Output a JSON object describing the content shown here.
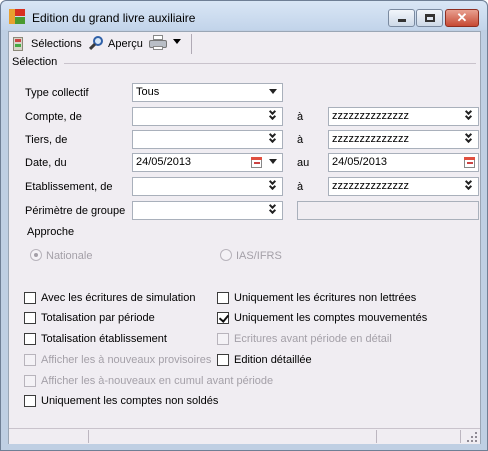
{
  "window": {
    "title": "Edition du grand livre auxiliaire",
    "close_glyph": "✕"
  },
  "toolbar": {
    "selections_label": "Sélections",
    "preview_label": "Aperçu",
    "icons": [
      "document-icon",
      "magnifier-icon",
      "printer-icon",
      "chevron-down-icon"
    ]
  },
  "section": {
    "title": "Sélection"
  },
  "form": {
    "type_collectif": {
      "label": "Type collectif",
      "value": "Tous"
    },
    "compte": {
      "label": "Compte, de",
      "from_value": "",
      "to_label": "à",
      "to_value": "zzzzzzzzzzzzzz"
    },
    "tiers": {
      "label": "Tiers, de",
      "from_value": "",
      "to_label": "à",
      "to_value": "zzzzzzzzzzzzzz"
    },
    "date": {
      "label": "Date, du",
      "from_value": "24/05/2013",
      "to_label": "au",
      "to_value": "24/05/2013"
    },
    "etablissement": {
      "label": "Etablissement, de",
      "from_value": "",
      "to_label": "à",
      "to_value": "zzzzzzzzzzzzzz"
    },
    "perimetre": {
      "label": "Périmètre de groupe",
      "value": "",
      "extra_value": ""
    }
  },
  "approche": {
    "label": "Approche",
    "options": [
      {
        "label": "Nationale",
        "checked": true,
        "enabled": false
      },
      {
        "label": "IAS/IFRS",
        "checked": false,
        "enabled": false
      }
    ]
  },
  "options": {
    "left": [
      {
        "label": "Avec les écritures de simulation",
        "checked": false,
        "enabled": true
      },
      {
        "label": "Totalisation par période",
        "checked": false,
        "enabled": true
      },
      {
        "label": "Totalisation établissement",
        "checked": false,
        "enabled": true
      },
      {
        "label": "Afficher les à nouveaux provisoires",
        "checked": false,
        "enabled": false
      },
      {
        "label": "Afficher les à-nouveaux en cumul avant période",
        "checked": false,
        "enabled": false
      },
      {
        "label": "Uniquement les comptes non soldés",
        "checked": false,
        "enabled": true
      }
    ],
    "right": [
      {
        "label": "Uniquement les écritures non lettrées",
        "checked": false,
        "enabled": true
      },
      {
        "label": "Uniquement les comptes mouvementés",
        "checked": true,
        "enabled": true
      },
      {
        "label": "Ecritures avant période en détail",
        "checked": false,
        "enabled": false
      },
      {
        "label": "Edition détaillée",
        "checked": false,
        "enabled": true
      }
    ]
  },
  "statusbar": {
    "panes": [
      "",
      "",
      ""
    ]
  }
}
